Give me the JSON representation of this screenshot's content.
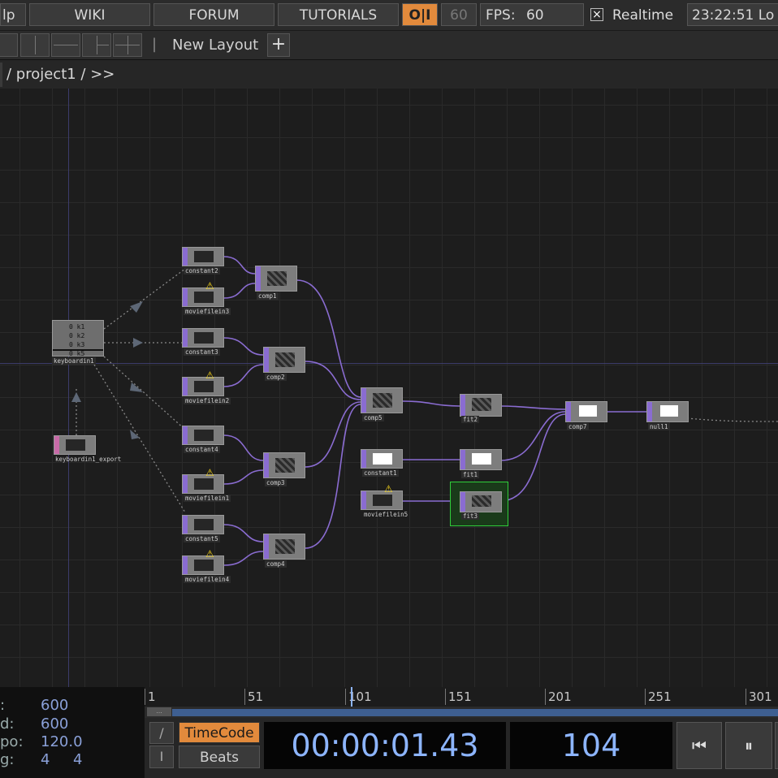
{
  "topbar": {
    "help_partial": "lp",
    "wiki": "WIKI",
    "forum": "FORUM",
    "tutorials": "TUTORIALS",
    "oi": "O|I",
    "fps_setting": "60",
    "fps_label": "FPS:",
    "fps_value": "60",
    "realtime_check": "×",
    "realtime_label": "Realtime",
    "clock": "23:22:51 Lo"
  },
  "layoutbar": {
    "separator": "|",
    "new_layout": "New Layout",
    "add": "+"
  },
  "pathbar": {
    "path": "/ project1 / >>"
  },
  "network": {
    "keyboard_rows": [
      "0  k1",
      "0  k2",
      "0  k3",
      "0  k5"
    ],
    "nodes": {
      "constant2": "constant2",
      "moviefilein3": "moviefilein3",
      "constant3": "constant3",
      "moviefilein2": "moviefilein2",
      "constant4": "constant4",
      "moviefilein1": "moviefilein1",
      "constant5": "constant5",
      "moviefilein4": "moviefilein4",
      "comp1": "comp1",
      "comp2": "comp2",
      "comp3": "comp3",
      "comp4": "comp4",
      "comp5": "comp5",
      "fit2": "fit2",
      "constant1": "constant1",
      "fit1": "fit1",
      "moviefilein5": "moviefilein5",
      "fit3": "fit3",
      "comp7": "comp7",
      "null1": "null1",
      "keyboardin1": "keyboardin1",
      "keyboardin1_export": "keyboardin1_export"
    }
  },
  "info": {
    "row1_key": ":",
    "row1_val": "600",
    "row2_key": "d:",
    "row2_val": "600",
    "row3_key": "po:",
    "row3_val": "120.0",
    "row4_key": "g:",
    "row4_val": "4     4"
  },
  "timeline": {
    "ticks": [
      "1",
      "51",
      "101",
      "151",
      "201",
      "251",
      "301"
    ],
    "range_handle": "...",
    "timecode_btn": "TimeCode",
    "beats_btn": "Beats",
    "slash": "/",
    "bar": "I",
    "timecode": "00:00:01.43",
    "frame": "104",
    "rewind": "⏮",
    "pause": "⏸"
  },
  "colors": {
    "accent_orange": "#e28a3c",
    "wire_purple": "#8a6cd1",
    "timecode_blue": "#8db5ff",
    "selected_green": "#2fcf3a"
  }
}
